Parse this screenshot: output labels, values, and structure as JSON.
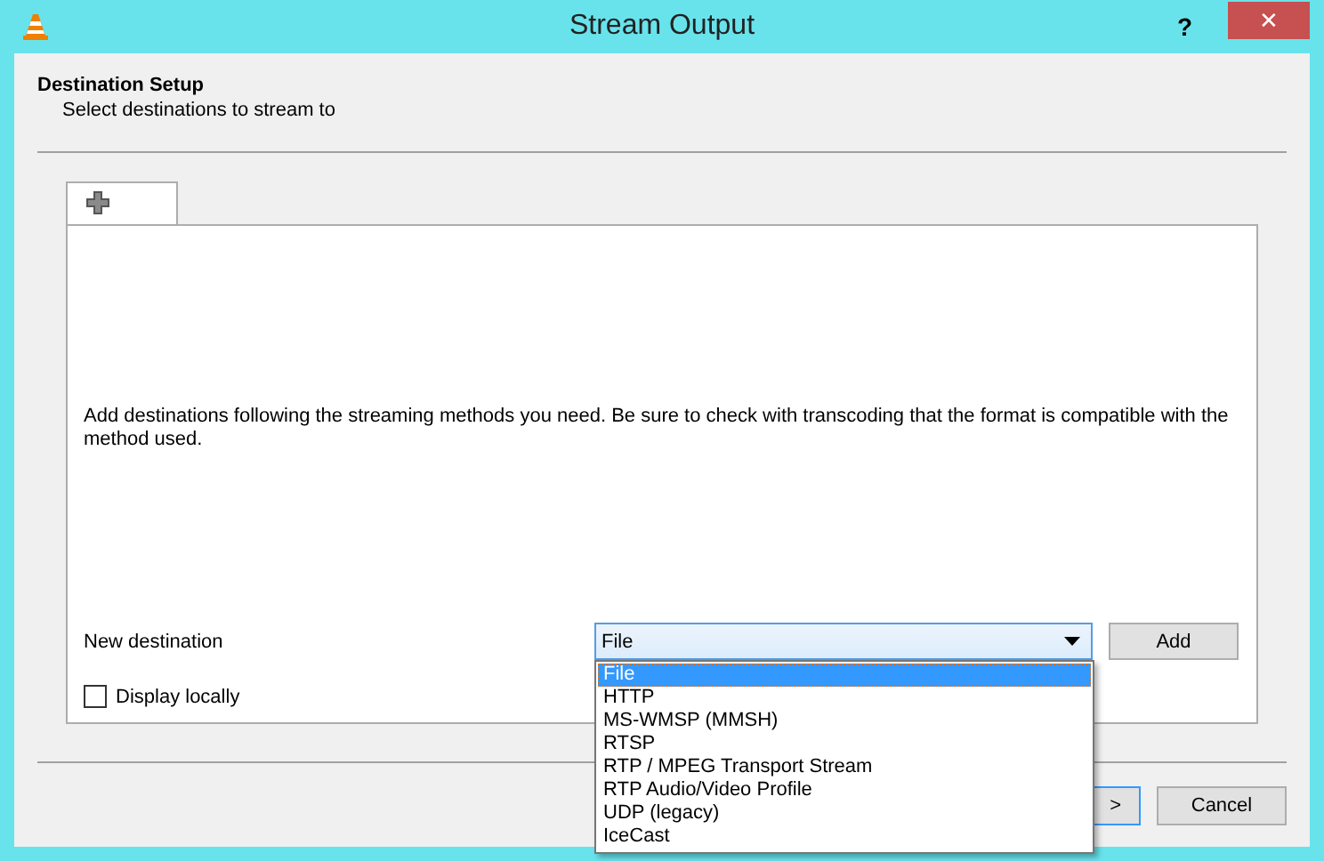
{
  "window": {
    "title": "Stream Output",
    "help": "?",
    "close": "✕"
  },
  "header": {
    "title": "Destination Setup",
    "subtitle": "Select destinations to stream to"
  },
  "tabs": [
    {
      "kind": "add",
      "selected": true
    }
  ],
  "panel": {
    "description": "Add destinations following the streaming methods you need. Be sure to check with transcoding that the format is compatible with the method used.",
    "new_destination_label": "New destination",
    "destination_combo": {
      "value": "File",
      "expanded": true,
      "options": [
        {
          "label": "File",
          "selected": true
        },
        {
          "label": "HTTP",
          "selected": false
        },
        {
          "label": "MS-WMSP (MMSH)",
          "selected": false
        },
        {
          "label": "RTSP",
          "selected": false
        },
        {
          "label": "RTP / MPEG Transport Stream",
          "selected": false
        },
        {
          "label": "RTP Audio/Video Profile",
          "selected": false
        },
        {
          "label": "UDP (legacy)",
          "selected": false
        },
        {
          "label": "IceCast",
          "selected": false
        }
      ]
    },
    "add_button": "Add",
    "display_locally": {
      "label": "Display locally",
      "checked": false
    }
  },
  "footer": {
    "next_button": ">",
    "cancel_button": "Cancel"
  }
}
